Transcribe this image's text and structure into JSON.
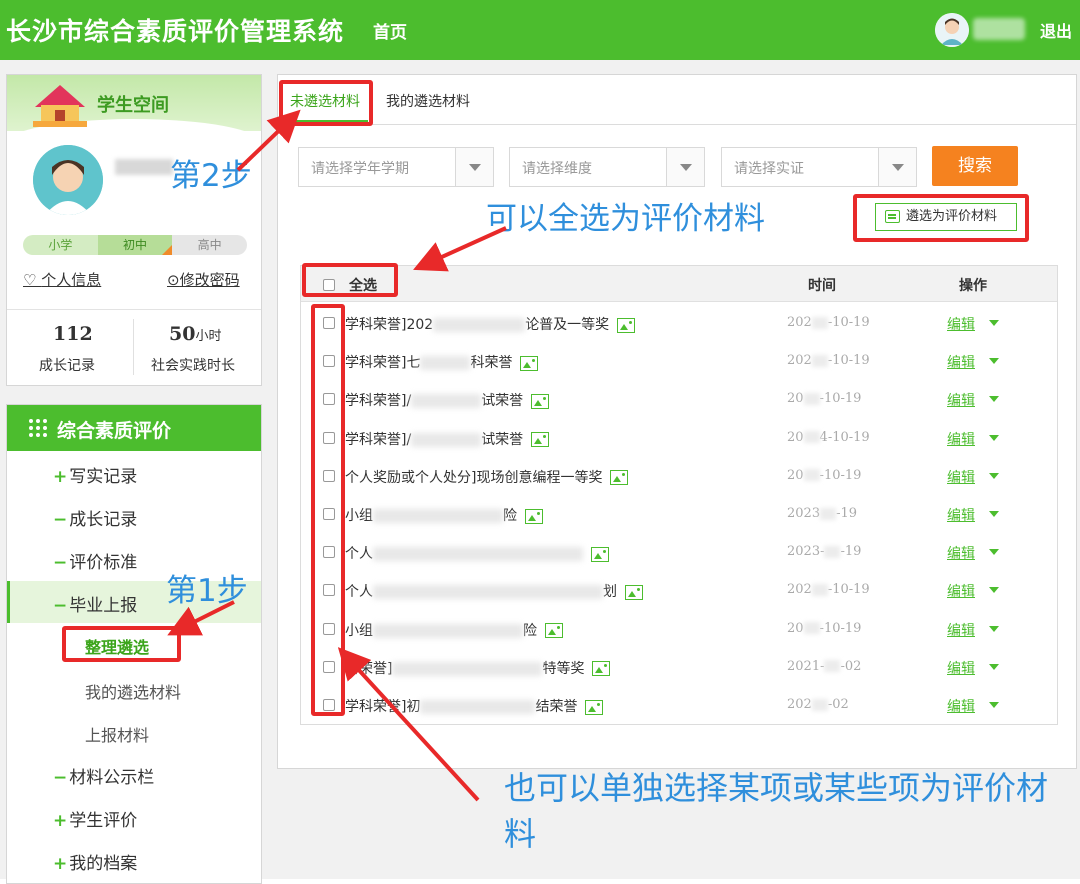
{
  "header": {
    "app_title": "长沙市综合素质评价管理系统",
    "nav_home": "首页",
    "logout": "退出"
  },
  "profile": {
    "space_title": "学生空间",
    "grades": [
      "小学",
      "初中",
      "高中"
    ],
    "personal_info": "个人信息",
    "change_password": "修改密码",
    "growth_count": "112",
    "growth_label": "成长记录",
    "practice_hours": "50",
    "practice_unit": "小时",
    "practice_label": "社会实践时长"
  },
  "menu": {
    "title": "综合素质评价",
    "items": [
      {
        "sym": "+",
        "label": "写实记录"
      },
      {
        "sym": "−",
        "label": "成长记录"
      },
      {
        "sym": "−",
        "label": "评价标准"
      },
      {
        "sym": "−",
        "label": "毕业上报"
      },
      {
        "sym": "−",
        "label": "材料公示栏"
      },
      {
        "sym": "+",
        "label": "学生评价"
      },
      {
        "sym": "+",
        "label": "我的档案"
      }
    ],
    "sub": [
      "整理遴选",
      "我的遴选材料",
      "上报材料"
    ]
  },
  "tabs": [
    "未遴选材料",
    "我的遴选材料"
  ],
  "filters": {
    "term": "请选择学年学期",
    "dimension": "请选择维度",
    "evidence": "请选择实证",
    "search": "搜索",
    "select_as_material": "遴选为评价材料"
  },
  "table": {
    "select_all": "全选",
    "col_time": "时间",
    "col_op": "操作",
    "edit_label": "编辑",
    "rows": [
      {
        "title": "学科荣誉]202",
        "title_tail": "论普及一等奖",
        "date": "202",
        "date_tail": "-10-19"
      },
      {
        "title": "学科荣誉]七",
        "title_tail": "科荣誉",
        "date": "202",
        "date_tail": "-10-19"
      },
      {
        "title": "学科荣誉]/",
        "title_tail": "试荣誉",
        "date": "20",
        "date_tail": "-10-19"
      },
      {
        "title": "学科荣誉]/",
        "title_tail": "试荣誉",
        "date": "20",
        "date_tail": "4-10-19"
      },
      {
        "title": "个人奖励或个人处分]现场创意编程一等奖",
        "title_tail": "",
        "date": "20",
        "date_tail": "-10-19"
      },
      {
        "title": "小组",
        "title_tail": "险",
        "date": "2023",
        "date_tail": "-19"
      },
      {
        "title": "个人",
        "title_tail": "",
        "date": "2023-",
        "date_tail": "-19"
      },
      {
        "title": "个人",
        "title_tail": "划",
        "date": "202",
        "date_tail": "-10-19"
      },
      {
        "title": "小组",
        "title_tail": "险",
        "date": "20",
        "date_tail": "-10-19"
      },
      {
        "title": "科荣誉]",
        "title_tail": "特等奖",
        "date": "2021-",
        "date_tail": "-02"
      },
      {
        "title": "学科荣誉]初",
        "title_tail": "结荣誉",
        "date": "202",
        "date_tail": "-02"
      }
    ]
  },
  "annotations": {
    "step1": "第1步",
    "step2": "第2步",
    "select_all_hint": "可以全选为评价材料",
    "single_hint": "也可以单独选择某项或某些项为评价材料"
  },
  "colors": {
    "brand_green": "#4cbd2e",
    "search_orange": "#f5821f",
    "annotation_red": "#e82929",
    "annotation_blue": "#2f8fdc"
  }
}
